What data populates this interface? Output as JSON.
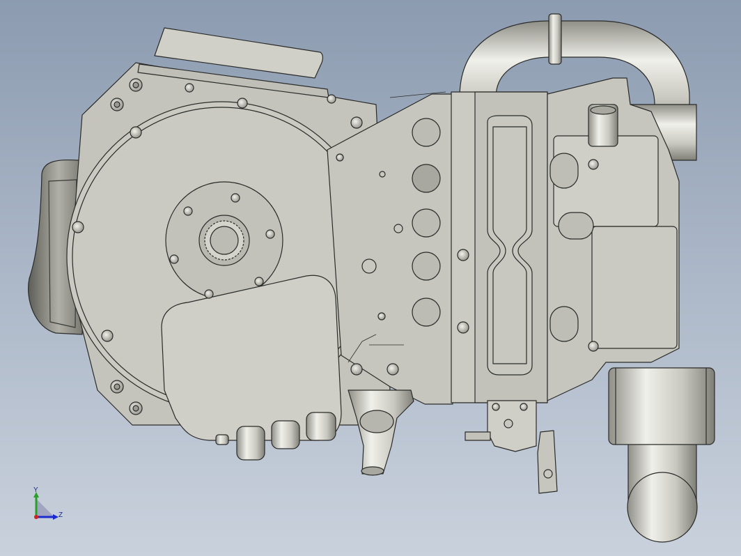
{
  "view": {
    "background_top": "#8c9bb0",
    "background_bottom": "#c9d1dc",
    "part_fill": "#c8c8c0",
    "edge_color": "#2a2a28"
  },
  "triad": {
    "axis_y_label": "Y",
    "axis_z_label": "Z",
    "axis_y_color": "#2aa02a",
    "axis_z_color": "#1a2ad0",
    "axis_x_color": "#d02020"
  }
}
